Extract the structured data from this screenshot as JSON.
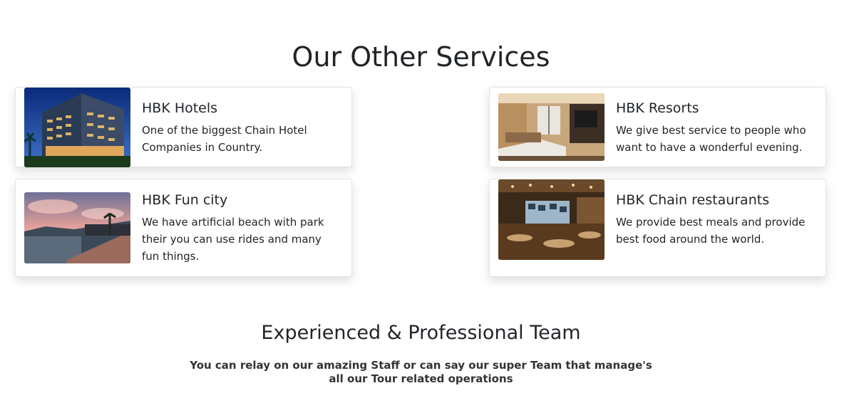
{
  "services": {
    "title": "Our Other Services",
    "items": [
      {
        "name": "HBK Hotels",
        "desc": "One of the biggest Chain Hotel Companies in Country.",
        "image": "hotel-building-image"
      },
      {
        "name": "HBK Resorts",
        "desc": "We give best service to people who want to have a wonderful evening.",
        "image": "resort-room-image"
      },
      {
        "name": "HBK Fun city",
        "desc": "We have artificial beach with park their you can use rides and many fun things.",
        "image": "beach-park-image"
      },
      {
        "name": "HBK Chain restaurants",
        "desc": "We provide best meals and provide best food around the world.",
        "image": "restaurant-interior-image"
      }
    ]
  },
  "team": {
    "title": "Experienced & Professional Team",
    "description": "You can relay on our amazing Staff or can say our super Team that manage's all our Tour related operations"
  }
}
